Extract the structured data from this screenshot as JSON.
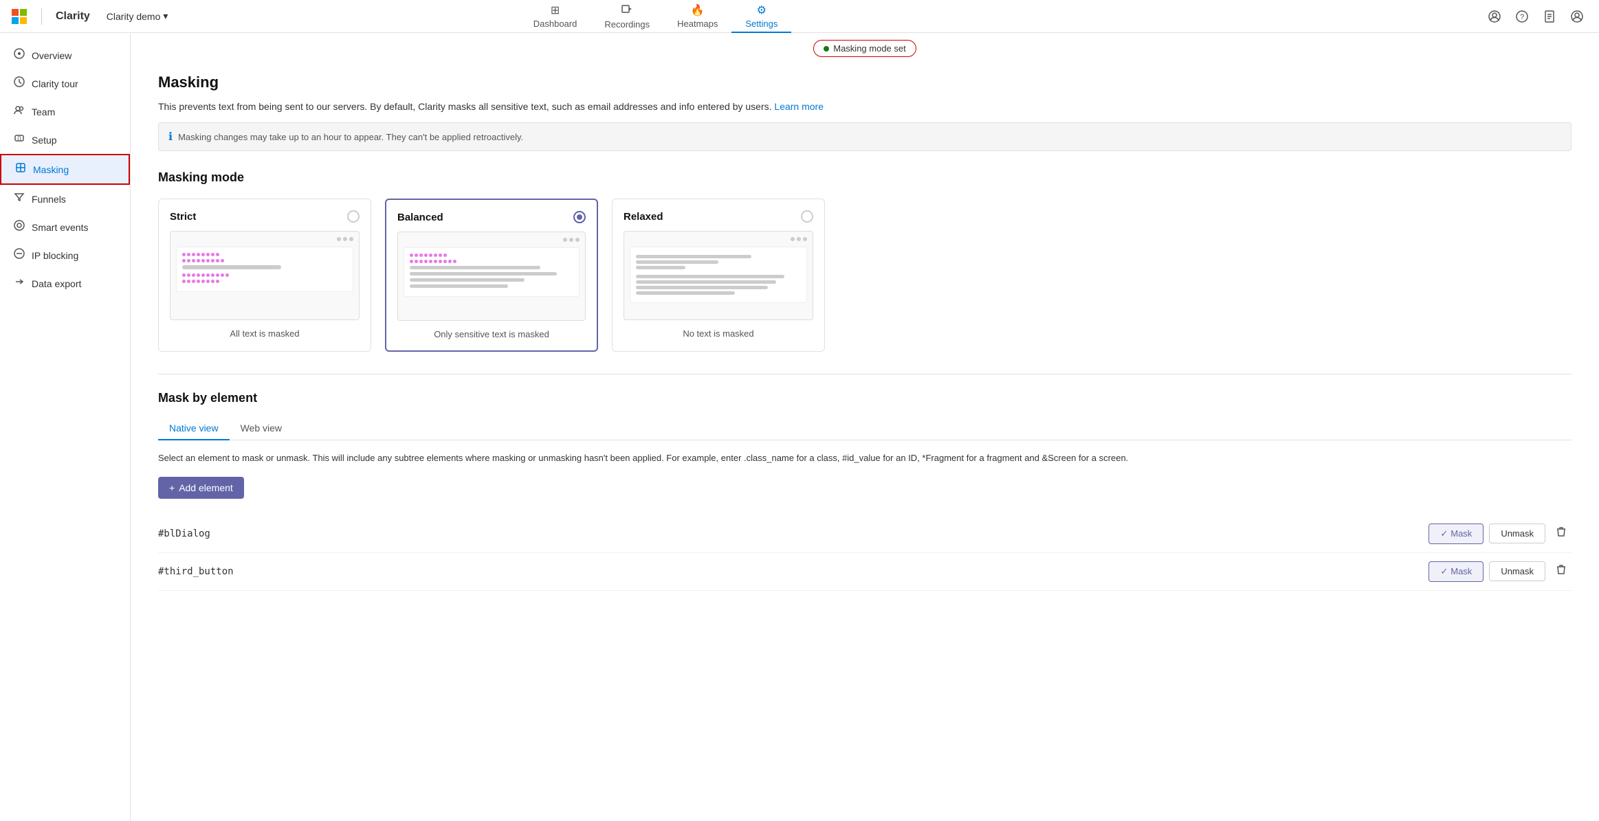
{
  "brand": {
    "ms_logo": "Microsoft",
    "app_name": "Clarity",
    "project_name": "Clarity demo",
    "project_arrow": "▾"
  },
  "nav": {
    "tabs": [
      {
        "id": "dashboard",
        "label": "Dashboard",
        "icon": "⊞",
        "active": false
      },
      {
        "id": "recordings",
        "label": "Recordings",
        "icon": "▶",
        "active": false
      },
      {
        "id": "heatmaps",
        "label": "Heatmaps",
        "icon": "🔥",
        "active": false
      },
      {
        "id": "settings",
        "label": "Settings",
        "icon": "⚙",
        "active": true
      }
    ],
    "actions": [
      {
        "id": "share",
        "icon": "👤"
      },
      {
        "id": "help",
        "icon": "?"
      },
      {
        "id": "document",
        "icon": "📄"
      },
      {
        "id": "user",
        "icon": "👤"
      }
    ]
  },
  "sidebar": {
    "items": [
      {
        "id": "overview",
        "label": "Overview",
        "icon": "⊙"
      },
      {
        "id": "clarity-tour",
        "label": "Clarity tour",
        "icon": "◎"
      },
      {
        "id": "team",
        "label": "Team",
        "icon": "◑"
      },
      {
        "id": "setup",
        "label": "Setup",
        "icon": "{ }"
      },
      {
        "id": "masking",
        "label": "Masking",
        "icon": "◈",
        "active": true
      },
      {
        "id": "funnels",
        "label": "Funnels",
        "icon": "⊂"
      },
      {
        "id": "smart-events",
        "label": "Smart events",
        "icon": "◉"
      },
      {
        "id": "ip-blocking",
        "label": "IP blocking",
        "icon": "⊕"
      },
      {
        "id": "data-export",
        "label": "Data export",
        "icon": "↪"
      }
    ]
  },
  "masking_badge": {
    "label": "Masking mode set"
  },
  "page": {
    "title": "Masking",
    "description": "This prevents text from being sent to our servers. By default, Clarity masks all sensitive text, such as email addresses and info entered by users.",
    "learn_more": "Learn more",
    "info_text": "Masking changes may take up to an hour to appear. They can't be applied retroactively."
  },
  "masking_mode": {
    "section_title": "Masking mode",
    "cards": [
      {
        "id": "strict",
        "title": "Strict",
        "selected": false,
        "caption": "All text is masked",
        "preview_type": "strict"
      },
      {
        "id": "balanced",
        "title": "Balanced",
        "selected": true,
        "caption": "Only sensitive text is masked",
        "preview_type": "balanced"
      },
      {
        "id": "relaxed",
        "title": "Relaxed",
        "selected": false,
        "caption": "No text is masked",
        "preview_type": "relaxed"
      }
    ]
  },
  "mask_by_element": {
    "section_title": "Mask by element",
    "tabs": [
      {
        "id": "native",
        "label": "Native view",
        "active": true
      },
      {
        "id": "web",
        "label": "Web view",
        "active": false
      }
    ],
    "description": "Select an element to mask or unmask. This will include any subtree elements where masking or unmasking hasn't been applied. For example, enter .class_name for a class, #id_value for an ID, *Fragment for a fragment and &Screen for a screen.",
    "add_button": "+ Add element",
    "elements": [
      {
        "id": "blDialog",
        "name": "#blDialog",
        "mask_active": true
      },
      {
        "id": "third_button",
        "name": "#third_button",
        "mask_active": true
      }
    ],
    "mask_label": "Mask",
    "unmask_label": "Unmask",
    "check_mark": "✓"
  }
}
